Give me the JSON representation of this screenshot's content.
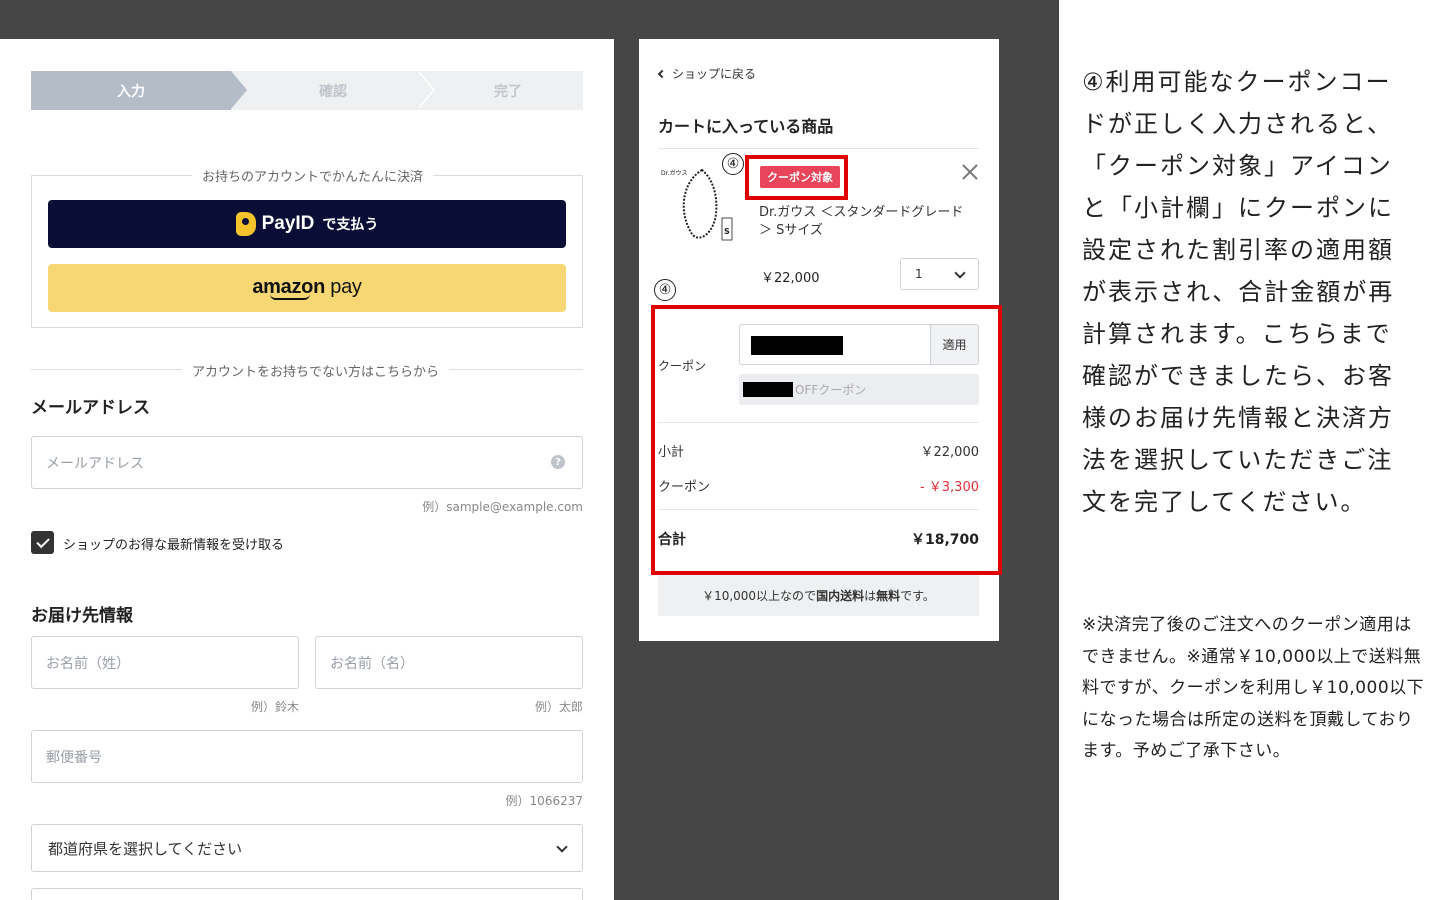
{
  "steps": [
    "入力",
    "確認",
    "完了"
  ],
  "account_section": {
    "legend": "お持ちのアカウントでかんたんに決済",
    "payid_name": "PayID",
    "payid_suffix": "で支払う",
    "amazon_word": "amazon",
    "amazon_pay": "pay"
  },
  "no_account_divider": "アカウントをお持ちでない方はこちらから",
  "email": {
    "title": "メールアドレス",
    "placeholder": "メールアドレス",
    "help": "?",
    "hint": "例）sample@example.com"
  },
  "newsletter": {
    "checked": true,
    "label": "ショップのお得な最新情報を受け取る"
  },
  "delivery": {
    "title": "お届け先情報",
    "last_name_placeholder": "お名前（姓）",
    "last_name_hint": "例）鈴木",
    "first_name_placeholder": "お名前（名）",
    "first_name_hint": "例）太郎",
    "postal_placeholder": "郵便番号",
    "postal_hint": "例）1066237",
    "prefecture_placeholder": "都道府県を選択してください"
  },
  "cart": {
    "back_label": "ショップに戻る",
    "title": "カートに入っている商品",
    "item": {
      "badge": "クーポン対象",
      "name": "Dr.ガウス ＜スタンダードグレード＞ Sサイズ",
      "price": "￥22,000",
      "qty": "1",
      "image_label": "Dr.ガウス",
      "size_tag": "S"
    },
    "coupon": {
      "label": "クーポン",
      "apply": "適用",
      "result_suffix": "OFFクーポン"
    },
    "subtotal_label": "小計",
    "subtotal_value": "￥22,000",
    "discount_label": "クーポン",
    "discount_value": "- ￥3,300",
    "total_label": "合計",
    "total_value": "￥18,700",
    "shipping_prefix": "￥10,000以上なので",
    "shipping_bold1": "国内送料",
    "shipping_mid": "は",
    "shipping_bold2": "無料",
    "shipping_suffix": "です。"
  },
  "annotations": {
    "badge_marker": "④",
    "summary_marker": "④",
    "highlight_color": "#e00000"
  },
  "explanation": {
    "main": "④利用可能なクーポンコードが正しく入力されると、「クーポン対象」アイコンと「小計欄」にクーポンに設定された割引率の適用額が表示され、合計金額が再計算されます。こちらまで確認ができましたら、お客様のお届け先情報と決済方法を選択していただきご注文を完了してください。",
    "note": "※決済完了後のご注文へのクーポン適用はできません。※通常￥10,000以上で送料無料ですが、クーポンを利用し￥10,000以下になった場合は所定の送料を頂戴しております。予めご了承下さい。"
  },
  "colors": {
    "backdrop": "#464646",
    "payid_bg": "#0a0d36",
    "payid_logo": "#f6c42a",
    "amazon_bg": "#f7d774",
    "badge": "#e8445a",
    "discount": "#e0303a"
  }
}
